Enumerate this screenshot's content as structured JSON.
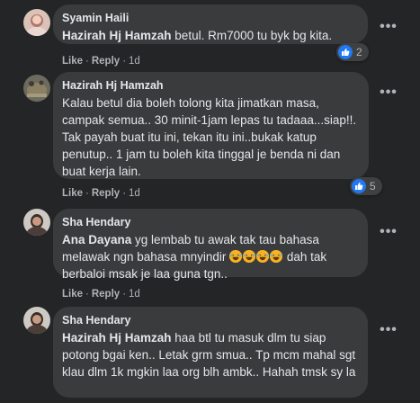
{
  "actions": {
    "like": "Like",
    "reply": "Reply",
    "sep": "·"
  },
  "more_glyph": "•••",
  "comments": [
    {
      "author": "Syamin Haili",
      "mention": "Hazirah Hj Hamzah",
      "text": " betul. Rm7000 tu byk bg kita.",
      "time": "1d",
      "reaction_count": "2"
    },
    {
      "author": "Hazirah Hj Hamzah",
      "mention": "",
      "text": "Kalau betul dia boleh tolong kita jimatkan masa, campak semua.. 30 minit-1jam lepas tu tadaaa...siap!!. Tak payah buat itu ini, tekan itu ini..bukak katup penutup.. 1 jam tu boleh kita tinggal je benda ni dan buat kerja lain.",
      "time": "1d",
      "reaction_count": "5"
    },
    {
      "author": "Sha Hendary",
      "mention": "Ana Dayana",
      "text_before": " yg lembab tu awak tak tau bahasa melawak ngn bahasa mnyindir ",
      "text_after": " dah tak berbaloi msak je laa guna tgn..",
      "emoji_name": "rolling-on-floor-laughing-emoji",
      "time": "1d"
    },
    {
      "author": "Sha Hendary",
      "mention": "Hazirah Hj Hamzah",
      "text": " haa btl tu masuk dlm tu siap potong bgai ken.. Letak grm smua.. Tp mcm mahal sgt klau dlm 1k mgkin laa org blh ambk.. Hahah tmsk sy la"
    }
  ]
}
